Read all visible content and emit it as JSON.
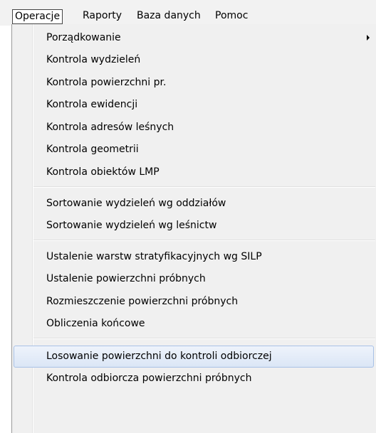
{
  "menubar": {
    "items": [
      {
        "label": "Operacje",
        "active": true
      },
      {
        "label": "Raporty"
      },
      {
        "label": "Baza danych"
      },
      {
        "label": "Pomoc"
      }
    ]
  },
  "menu": {
    "items": [
      {
        "label": "Porządkowanie",
        "submenu": true
      },
      {
        "label": "Kontrola wydzieleń"
      },
      {
        "label": "Kontrola powierzchni pr."
      },
      {
        "label": "Kontrola ewidencji"
      },
      {
        "label": "Kontrola adresów leśnych"
      },
      {
        "label": "Kontrola geometrii"
      },
      {
        "label": "Kontrola obiektów LMP"
      },
      {
        "label": "Sortowanie wydzieleń wg oddziałów"
      },
      {
        "label": "Sortowanie wydzieleń wg leśnictw"
      },
      {
        "label": "Ustalenie warstw stratyfikacyjnych wg SILP"
      },
      {
        "label": "Ustalenie powierzchni próbnych"
      },
      {
        "label": "Rozmieszczenie powierzchni próbnych"
      },
      {
        "label": "Obliczenia końcowe"
      },
      {
        "label": "Losowanie powierzchni do kontroli odbiorczej",
        "highlighted": true
      },
      {
        "label": "Kontrola odbiorcza powierzchni próbnych"
      }
    ]
  }
}
